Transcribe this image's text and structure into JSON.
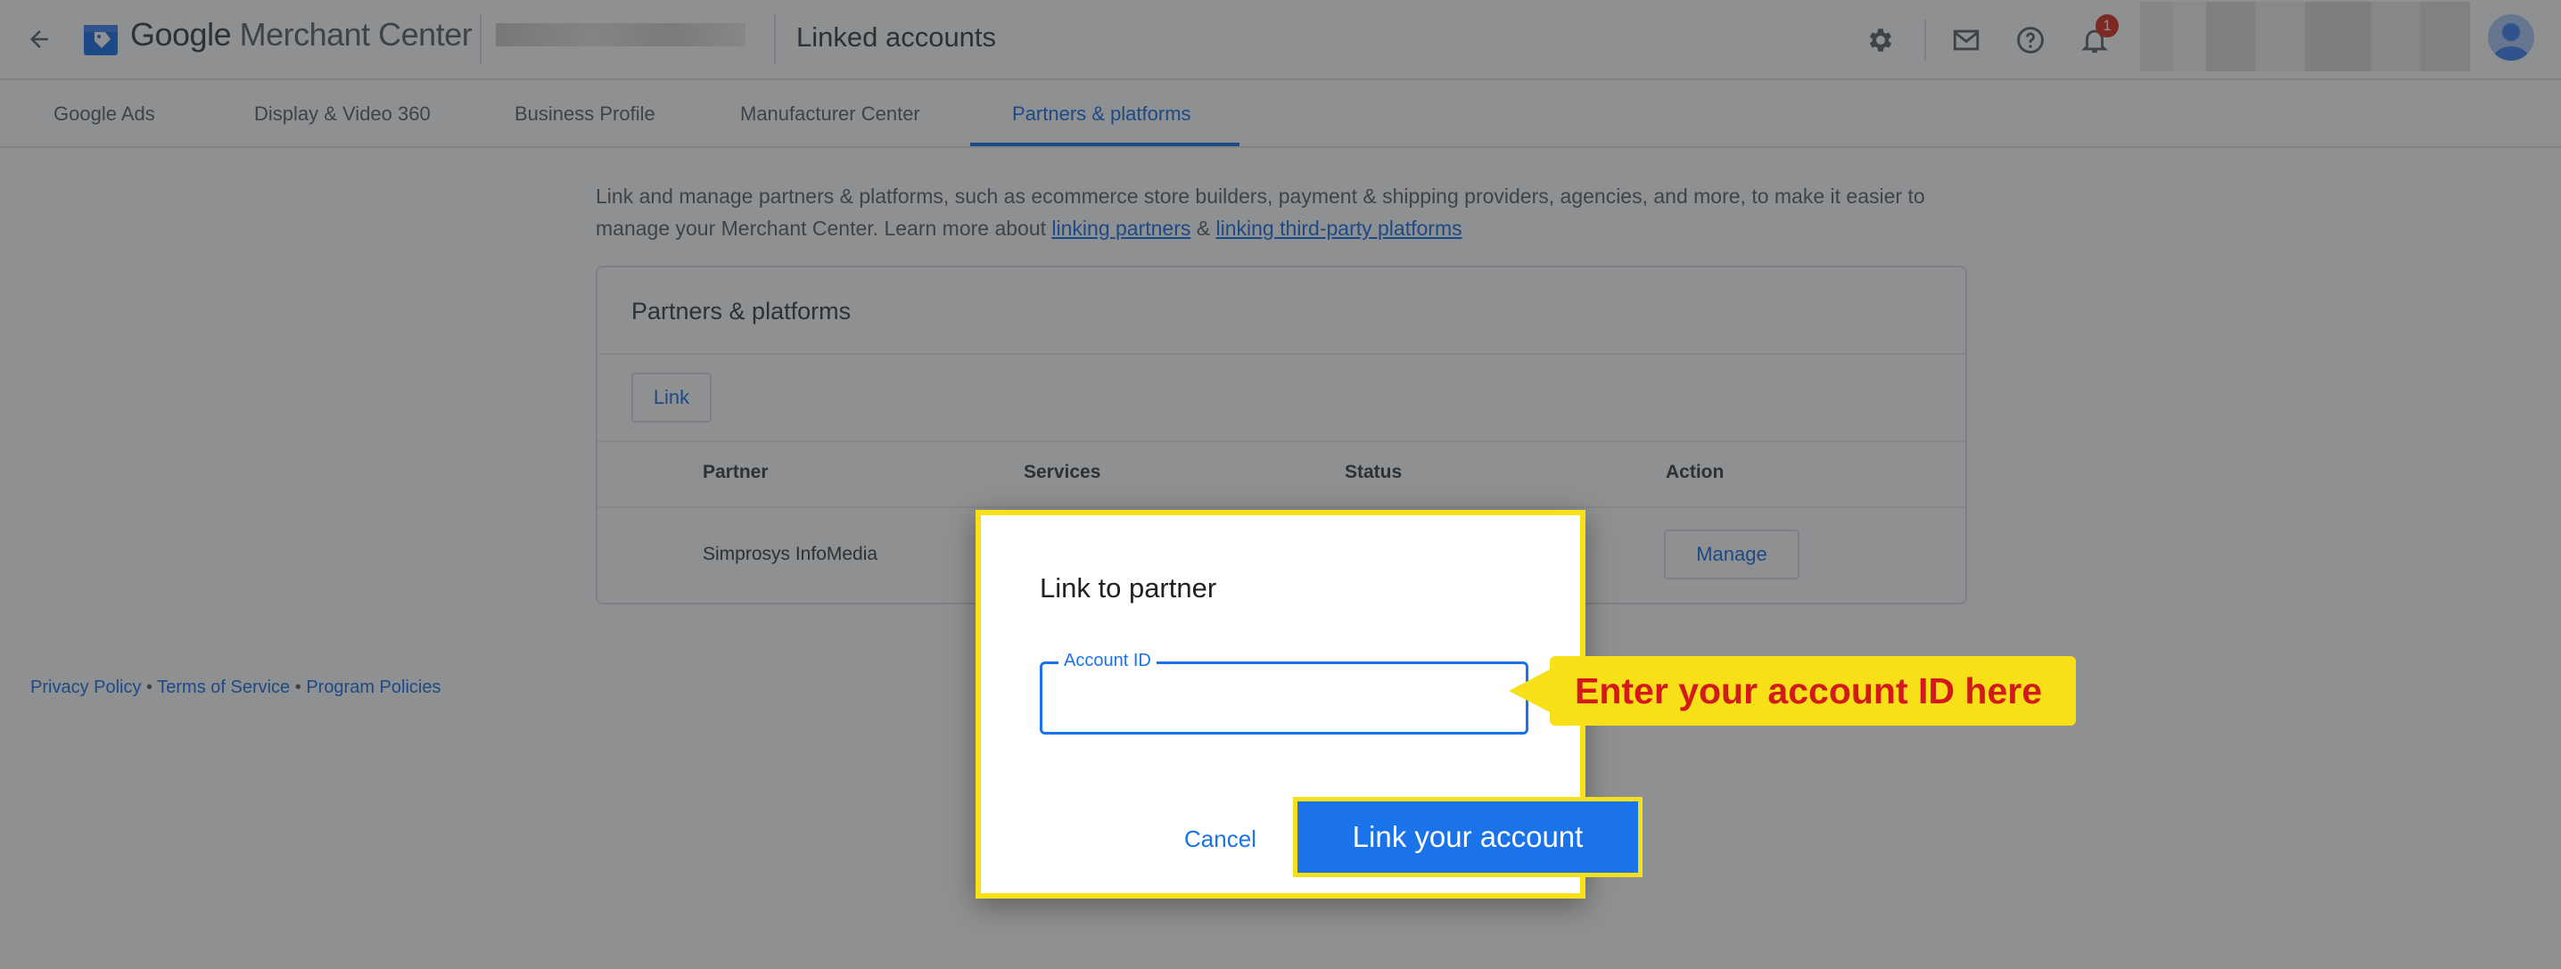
{
  "header": {
    "app_name_prefix": "Google",
    "app_name_rest": " Merchant Center",
    "page_title": "Linked accounts",
    "notification_count": "1"
  },
  "tabs": [
    {
      "label": "Google Ads"
    },
    {
      "label": "Display & Video 360"
    },
    {
      "label": "Business Profile"
    },
    {
      "label": "Manufacturer Center"
    },
    {
      "label": "Partners & platforms",
      "active": true
    }
  ],
  "intro": {
    "text": "Link and manage partners & platforms, such as ecommerce store builders, payment & shipping providers, agencies, and more, to make it easier to manage your Merchant Center. Learn more about ",
    "link1": "linking partners",
    "amp": " & ",
    "link2": "linking third-party platforms"
  },
  "card": {
    "title": "Partners & platforms",
    "link_button": "Link",
    "columns": [
      "Partner",
      "Services",
      "Status",
      "Action"
    ],
    "rows": [
      {
        "partner": "Simprosys InfoMedia",
        "action": "Manage"
      }
    ]
  },
  "footer": {
    "privacy": "Privacy Policy",
    "terms": "Terms of Service",
    "program": "Program Policies",
    "sep": " • "
  },
  "dialog": {
    "title": "Link to partner",
    "field_label": "Account ID",
    "field_value": "",
    "cancel": "Cancel",
    "submit": "Link your account"
  },
  "callout": {
    "text": "Enter your account ID here"
  },
  "colors": {
    "primary": "#1a73e8",
    "highlight": "#f7e017",
    "callout_text": "#d21a1a",
    "badge": "#d93025"
  }
}
